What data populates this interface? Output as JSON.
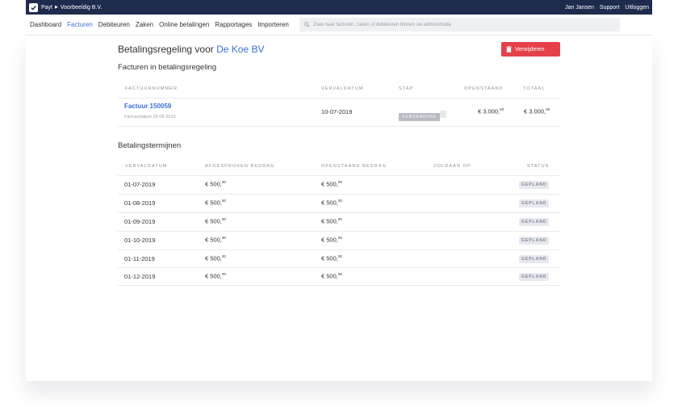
{
  "topbar": {
    "org_breadcrumb": [
      "Payt",
      "Voorbeeldig B.V."
    ],
    "user": "Jan Jansen",
    "support": "Support",
    "logout": "Uitloggen",
    "background_color": "#1e2b4d"
  },
  "nav": {
    "items": [
      "Dashboard",
      "Facturen",
      "Debiteuren",
      "Zaken",
      "Online betalingen",
      "Rapportages",
      "Importeren"
    ],
    "active": "Facturen",
    "search_placeholder": "Zoek naar facturen, zaken of debiteuren binnen uw administratie"
  },
  "header": {
    "title_prefix": "Betalingsregeling voor",
    "debtor_name": "De Koe BV",
    "delete_label": "Verwijderen"
  },
  "invoices": {
    "section_title": "Facturen in betalingsregeling",
    "columns": [
      "Factuurnummer",
      "Vervaldatum",
      "Stap",
      "Openstaand",
      "Totaal"
    ],
    "rows": [
      {
        "number": "Factuur 150059",
        "invoice_date": "Factuurdatum 25-06-2019",
        "due_date": "10-07-2019",
        "step": "VERZENDING",
        "outstanding_main": "€ 3.000,",
        "outstanding_cents": "00",
        "total_main": "€ 3.000,",
        "total_cents": "00"
      }
    ]
  },
  "terms": {
    "section_title": "Betalingstermijnen",
    "columns": [
      "Vervaldatum",
      "Afgesproken bedrag",
      "Openstaand bedrag",
      "Voldaan op",
      "Status"
    ],
    "rows": [
      {
        "due_date": "01-07-2019",
        "agreed_main": "€ 500,",
        "agreed_cents": "00",
        "open_main": "€ 500,",
        "open_cents": "00",
        "paid_on": "",
        "status": "GEPLAND"
      },
      {
        "due_date": "01-08-2019",
        "agreed_main": "€ 500,",
        "agreed_cents": "00",
        "open_main": "€ 500,",
        "open_cents": "00",
        "paid_on": "",
        "status": "GEPLAND"
      },
      {
        "due_date": "01-09-2019",
        "agreed_main": "€ 500,",
        "agreed_cents": "00",
        "open_main": "€ 500,",
        "open_cents": "00",
        "paid_on": "",
        "status": "GEPLAND"
      },
      {
        "due_date": "01-10-2019",
        "agreed_main": "€ 500,",
        "agreed_cents": "00",
        "open_main": "€ 500,",
        "open_cents": "00",
        "paid_on": "",
        "status": "GEPLAND"
      },
      {
        "due_date": "01-11-2019",
        "agreed_main": "€ 500,",
        "agreed_cents": "00",
        "open_main": "€ 500,",
        "open_cents": "00",
        "paid_on": "",
        "status": "GEPLAND"
      },
      {
        "due_date": "01-12-2019",
        "agreed_main": "€ 500,",
        "agreed_cents": "00",
        "open_main": "€ 500,",
        "open_cents": "00",
        "paid_on": "",
        "status": "GEPLAND"
      }
    ]
  },
  "colors": {
    "accent": "#3b6fd4",
    "danger": "#e4414b"
  }
}
